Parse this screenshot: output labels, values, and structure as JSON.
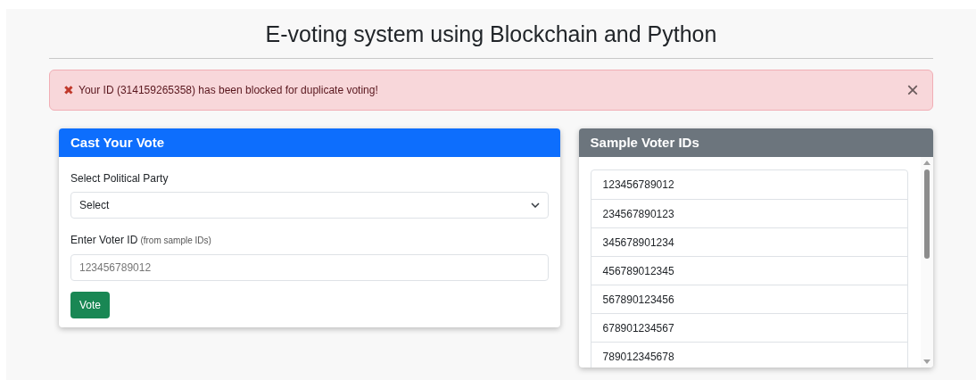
{
  "title": "E-voting system using Blockchain and Python",
  "alert": {
    "icon": "✖",
    "message": "Your ID (314159265358) has been blocked for duplicate voting!",
    "close": "×"
  },
  "vote_card": {
    "header": "Cast Your Vote",
    "party_label": "Select Political Party",
    "party_select": {
      "value": "Select"
    },
    "voter_label": "Enter Voter ID",
    "voter_hint": "(from sample IDs)",
    "voter_field": {
      "placeholder": "123456789012"
    },
    "button": "Vote"
  },
  "sample_card": {
    "header": "Sample Voter IDs",
    "ids": [
      "123456789012",
      "234567890123",
      "345678901234",
      "456789012345",
      "567890123456",
      "678901234567",
      "789012345678"
    ]
  }
}
